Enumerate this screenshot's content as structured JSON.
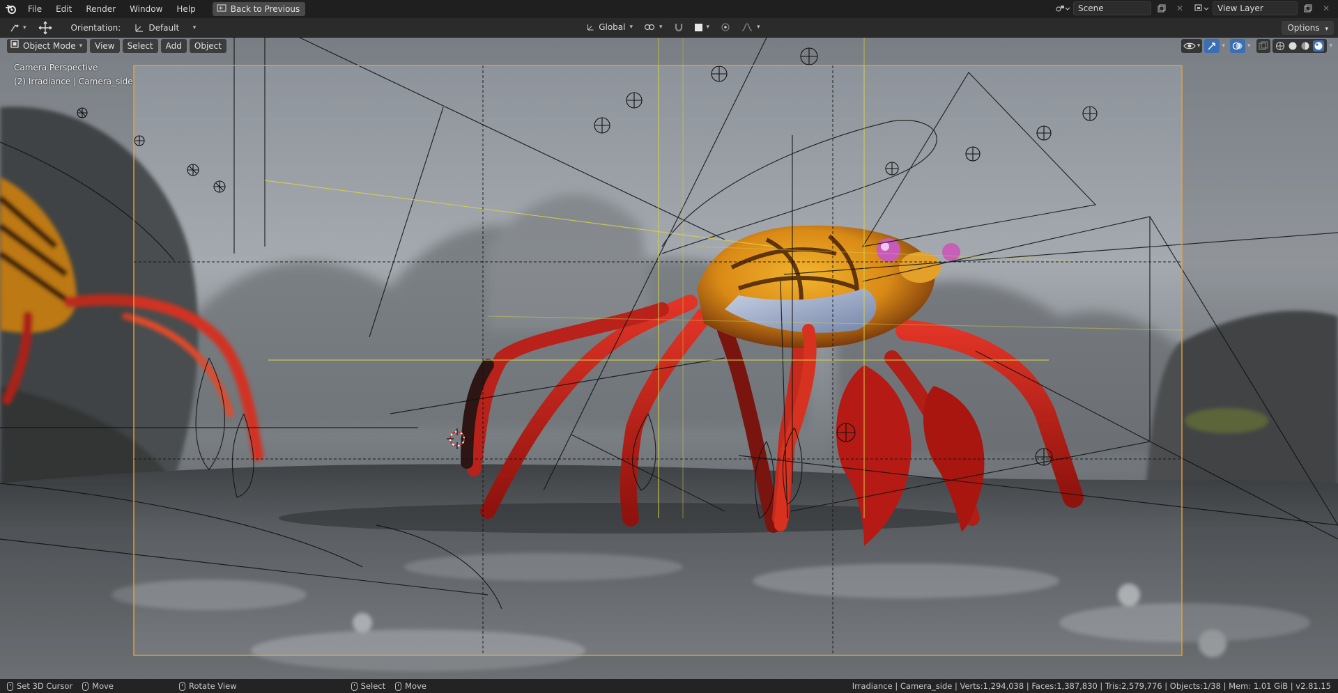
{
  "menu": {
    "items": [
      "File",
      "Edit",
      "Render",
      "Window",
      "Help"
    ],
    "back_label": "Back to Previous"
  },
  "workspace": {
    "scene_name": "Scene",
    "view_layer": "View Layer"
  },
  "tool_header": {
    "orientation_label": "Orientation:",
    "orientation_value": "Default",
    "transform_orientation": "Global",
    "options_label": "Options"
  },
  "viewport_header": {
    "mode": "Object Mode",
    "menus": [
      "View",
      "Select",
      "Add",
      "Object"
    ]
  },
  "camera_info": {
    "perspective": "Camera Perspective",
    "object_line": "(2) Irradiance | Camera_side"
  },
  "statusbar": {
    "hints": [
      "Set 3D Cursor",
      "Move",
      "Rotate View",
      "Select",
      "Move"
    ],
    "stats": "Irradiance | Camera_side | Verts:1,294,038 | Faces:1,387,830 | Tris:2,579,776 | Objects:1/38 | Mem: 1.01 GiB | v2.81.15"
  },
  "colors": {
    "camera_frame": "#f0a030",
    "crab_red": "#c8231a",
    "crab_orange": "#e9a21f"
  }
}
